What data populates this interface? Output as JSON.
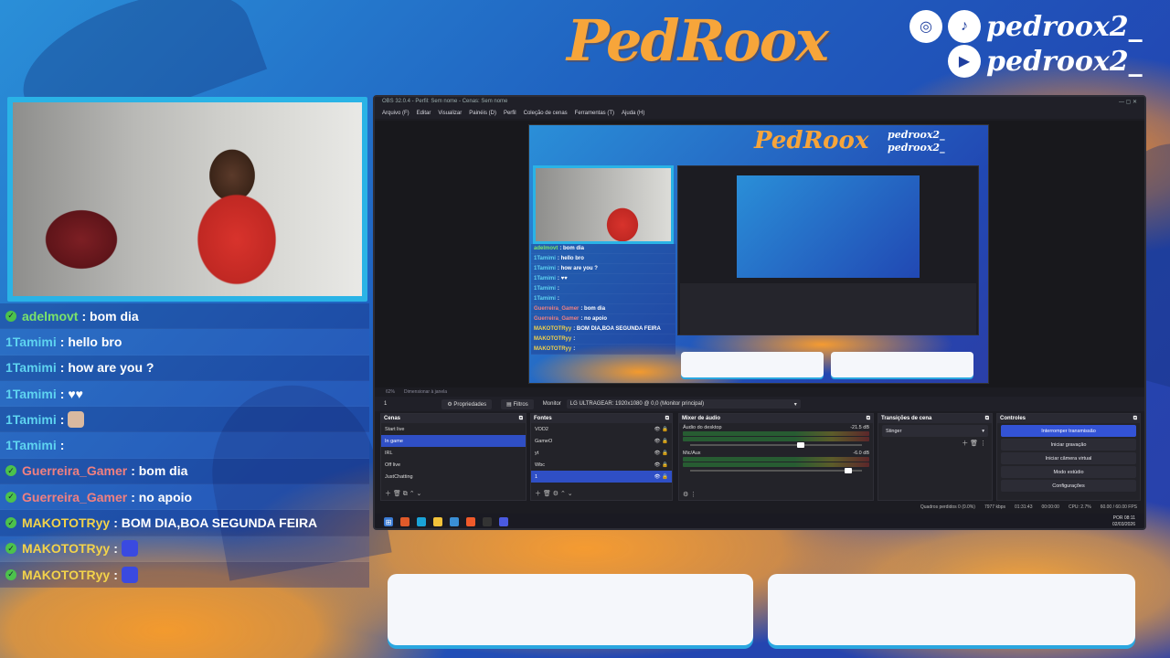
{
  "brand": {
    "logo": "PedRoox"
  },
  "socials": [
    {
      "icons": [
        "instagram-icon",
        "tiktok-icon"
      ],
      "glyphs": [
        "◎",
        "♪"
      ],
      "handle": "pedroox2_"
    },
    {
      "icons": [
        "youtube-icon"
      ],
      "glyphs": [
        "▶"
      ],
      "handle": "pedroox2_"
    }
  ],
  "chat": [
    {
      "user": "adelmovt",
      "message": ": bom dia",
      "user_color": "#7be36a",
      "badge": true,
      "emote": null
    },
    {
      "user": "1Tamimi",
      "message": ": hello bro",
      "user_color": "#5ed3f0",
      "badge": false,
      "emote": null
    },
    {
      "user": "1Tamimi",
      "message": ": how are you ?",
      "user_color": "#5ed3f0",
      "badge": false,
      "emote": null
    },
    {
      "user": "1Tamimi",
      "message": ": ♥♥",
      "user_color": "#5ed3f0",
      "badge": false,
      "emote": null
    },
    {
      "user": "1Tamimi",
      "message": ":",
      "user_color": "#5ed3f0",
      "badge": false,
      "emote": "#d9b9a0"
    },
    {
      "user": "1Tamimi",
      "message": ":",
      "user_color": "#5ed3f0",
      "badge": false,
      "emote": null
    },
    {
      "user": "Guerreira_Gamer",
      "message": ": bom dia",
      "user_color": "#f08080",
      "badge": true,
      "emote": null
    },
    {
      "user": "Guerreira_Gamer",
      "message": ": no apoio",
      "user_color": "#f08080",
      "badge": true,
      "emote": null
    },
    {
      "user": "MAKOTOTRyy",
      "message": ": BOM DIA,BOA SEGUNDA FEIRA",
      "user_color": "#f3d34a",
      "badge": true,
      "emote": null
    },
    {
      "user": "MAKOTOTRyy",
      "message": ":",
      "user_color": "#f3d34a",
      "badge": true,
      "emote": "#3a4ae0"
    },
    {
      "user": "MAKOTOTRyy",
      "message": ":",
      "user_color": "#f3d34a",
      "badge": true,
      "emote": "#3a4ae0"
    }
  ],
  "obs": {
    "title": "OBS 32.0.4 - Perfil: Sem nome - Cenas: Sem nome",
    "menu": [
      "Arquivo (F)",
      "Editar",
      "Visualizar",
      "Painéis (D)",
      "Perfil",
      "Coleção de cenas",
      "Ferramentas (T)",
      "Ajuda (H)"
    ],
    "zoom": "62%",
    "fit_label": "Dimensionar à janela",
    "source_selected": "1",
    "toolbar": {
      "properties": "Propriedades",
      "filters": "Filtros",
      "monitor_label": "Monitor",
      "monitor_value": "LG ULTRAGEAR: 1920x1080 @ 0,0 (Monitor principal)"
    },
    "scenes": {
      "title": "Cenas",
      "items": [
        "Start live",
        "In game",
        "IRL",
        "Off live",
        "JustChatting"
      ],
      "selected": 1
    },
    "sources": {
      "title": "Fontes",
      "items": [
        "VOD2",
        "GameO",
        "yt",
        "Wbc",
        "1"
      ],
      "selected": 4
    },
    "mixer": {
      "title": "Mixer de áudio",
      "channels": [
        {
          "name": "Áudio do desktop",
          "db": "-21.5 dB",
          "level": 0.62
        },
        {
          "name": "Mic/Aux",
          "db": "-6.0 dB",
          "level": 0.9
        }
      ]
    },
    "transitions": {
      "title": "Transições de cena",
      "value": "Stinger"
    },
    "controls": {
      "title": "Controles",
      "buttons": [
        "Interromper transmissão",
        "Iniciar gravação",
        "Iniciar câmera virtual",
        "Modo estúdio",
        "Configurações"
      ]
    },
    "status": {
      "frames": "Quadros perdidos 0 (0.0%)",
      "bitrate": "7977 kbps",
      "live_time": "01:31:43",
      "rec_time": "00:00:00",
      "cpu": "CPU: 2.7%",
      "fps": "60.00 / 60.00 FPS"
    },
    "tray": {
      "lang": "POR",
      "time": "08:11",
      "date": "02/03/2026"
    }
  },
  "preview": {
    "brand": "PedRoox",
    "handles": [
      "pedroox2_",
      "pedroox2_"
    ],
    "chat": [
      {
        "user": "adelmovt",
        "message": ": bom dia",
        "color": "#7be36a"
      },
      {
        "user": "1Tamimi",
        "message": ": hello bro",
        "color": "#5ed3f0"
      },
      {
        "user": "1Tamimi",
        "message": ": how are you ?",
        "color": "#5ed3f0"
      },
      {
        "user": "1Tamimi",
        "message": ": ♥♥",
        "color": "#5ed3f0"
      },
      {
        "user": "1Tamimi",
        "message": ":",
        "color": "#5ed3f0"
      },
      {
        "user": "1Tamimi",
        "message": ":",
        "color": "#5ed3f0"
      },
      {
        "user": "Guerreira_Gamer",
        "message": ": bom dia",
        "color": "#f08080"
      },
      {
        "user": "Guerreira_Gamer",
        "message": ": no apoio",
        "color": "#f08080"
      },
      {
        "user": "MAKOTOTRyy",
        "message": ": BOM DIA,BOA SEGUNDA FEIRA",
        "color": "#f3d34a"
      },
      {
        "user": "MAKOTOTRyy",
        "message": ":",
        "color": "#f3d34a"
      },
      {
        "user": "MAKOTOTRyy",
        "message": ":",
        "color": "#f3d34a"
      }
    ]
  },
  "colors": {
    "accent": "#2ab3e6",
    "brand": "#f7a53a",
    "obs_primary": "#3353d6"
  }
}
